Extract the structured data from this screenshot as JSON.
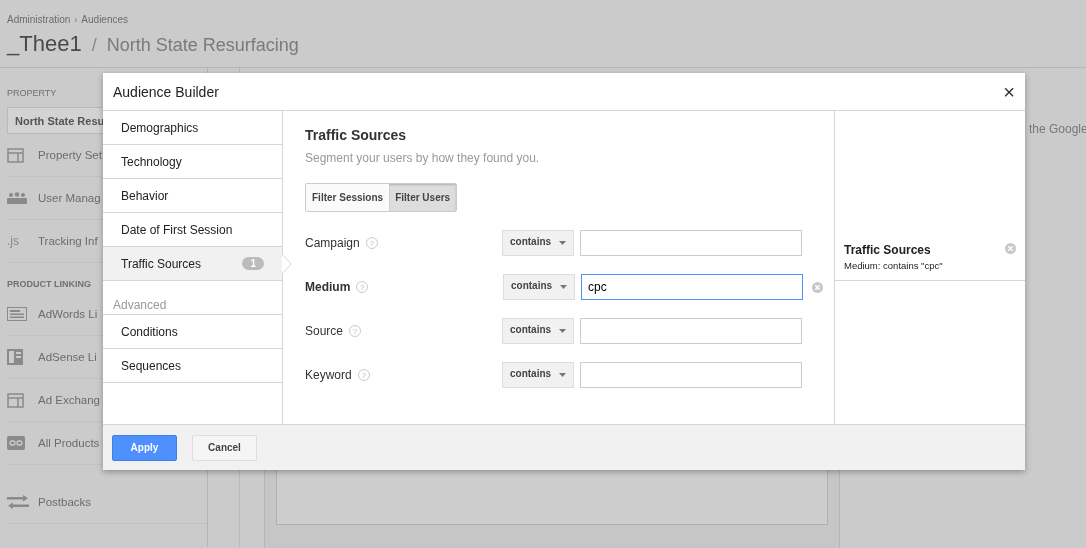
{
  "breadcrumb": [
    {
      "label": "Administration"
    },
    {
      "label": "Audiences"
    }
  ],
  "breadcrumb_separator": "›",
  "page_title": {
    "account": "_Thee1",
    "separator": "/",
    "property": "North State Resurfacing"
  },
  "sidebar": {
    "property_label": "PROPERTY",
    "property_dropdown": "North State Resu",
    "groups": [
      {
        "items": [
          {
            "kind": "panel",
            "label": "Property Set"
          },
          {
            "kind": "users",
            "label": "User Manag"
          },
          {
            "kind": "js",
            "icon_text": ".js",
            "label": "Tracking Inf"
          }
        ]
      },
      {
        "header": "PRODUCT LINKING",
        "items": [
          {
            "kind": "lines",
            "label": "AdWords Li"
          },
          {
            "kind": "grid",
            "label": "AdSense Li"
          },
          {
            "kind": "panel",
            "label": "Ad Exchang"
          },
          {
            "kind": "link",
            "label": "All Products"
          }
        ]
      },
      {
        "items": [
          {
            "kind": "arrows",
            "label": "Postbacks"
          }
        ]
      }
    ]
  },
  "background_text": "the Google",
  "dialog": {
    "title": "Audience Builder",
    "close": "×",
    "nav": [
      {
        "kind": "item",
        "label": "Demographics",
        "selected": false
      },
      {
        "kind": "item",
        "label": "Technology",
        "selected": false
      },
      {
        "kind": "item",
        "label": "Behavior",
        "selected": false
      },
      {
        "kind": "item",
        "label": "Date of First Session",
        "selected": false
      },
      {
        "kind": "item",
        "label": "Traffic Sources",
        "selected": true,
        "badge": "1"
      },
      {
        "kind": "header",
        "label": "Advanced"
      },
      {
        "kind": "item",
        "label": "Conditions",
        "selected": false
      },
      {
        "kind": "item",
        "label": "Sequences",
        "selected": false
      }
    ],
    "section": {
      "title": "Traffic Sources",
      "subtitle": "Segment your users by how they found you.",
      "filter_toggle": [
        {
          "label": "Filter Sessions",
          "selected": false
        },
        {
          "label": "Filter Users",
          "selected": true
        }
      ],
      "conditions": [
        {
          "label": "Campaign",
          "help": "?",
          "operator": "contains",
          "active": false
        },
        {
          "label": "Medium",
          "help": "?",
          "operator": "contains",
          "value": "cpc",
          "active": true
        },
        {
          "label": "Source",
          "help": "?",
          "operator": "contains",
          "active": false
        },
        {
          "label": "Keyword",
          "help": "?",
          "operator": "contains",
          "active": false
        }
      ]
    },
    "summary": [
      {
        "title": "Traffic Sources",
        "description": "Medium: contains \"cpc\""
      }
    ],
    "buttons": [
      {
        "kind": "primary",
        "label": "Apply"
      },
      {
        "kind": "secondary",
        "label": "Cancel"
      }
    ]
  }
}
